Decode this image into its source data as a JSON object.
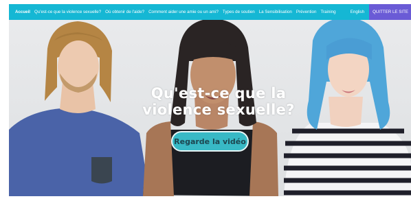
{
  "nav": {
    "items": [
      {
        "label": "Accueil"
      },
      {
        "label": "Qu'est-ce que la violence sexuelle?"
      },
      {
        "label": "Où obtenir de l'aide?"
      },
      {
        "label": "Comment aider une amie ou un ami?"
      },
      {
        "label": "Types de soutien"
      },
      {
        "label": "La Sensibilisation"
      },
      {
        "label": "Prévention"
      },
      {
        "label": "Training"
      }
    ],
    "language_toggle": "English",
    "quit_button": "QUITTER LE SITE"
  },
  "hero": {
    "headline_line1": "Qu'est-ce que la",
    "headline_line2": "violence sexuelle?",
    "cta_label": "Regarde la vidéo"
  },
  "colors": {
    "nav_bg": "#15b7d4",
    "quit_bg": "#6a5bd6",
    "cta_bg": "#38b9c5"
  }
}
